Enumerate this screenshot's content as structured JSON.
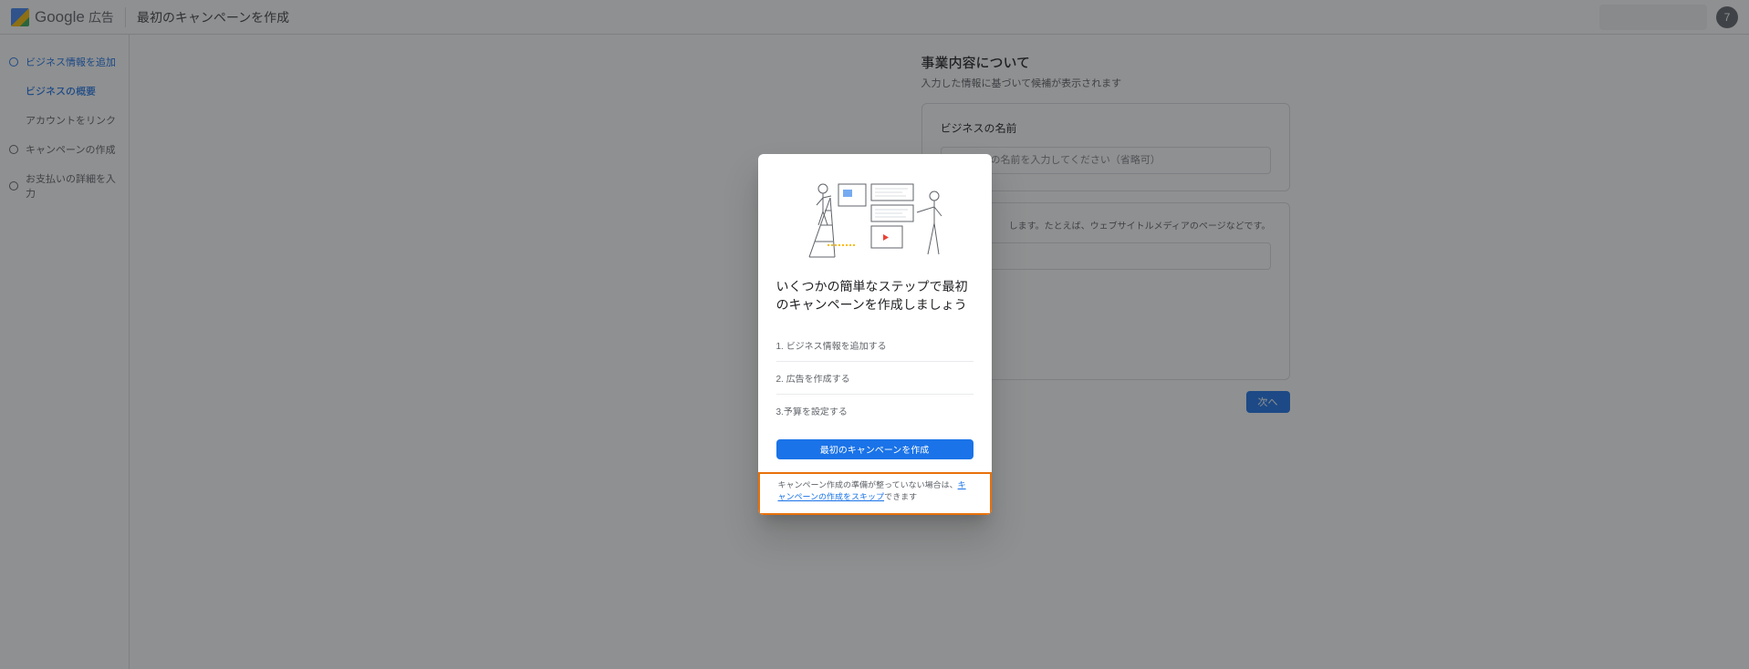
{
  "header": {
    "brand": "Google",
    "brand_suffix": "広告",
    "page_title": "最初のキャンペーンを作成",
    "avatar_initial": "7"
  },
  "sidebar": {
    "step1": "ビジネス情報を追加",
    "step1_sub1": "ビジネスの概要",
    "step1_sub2": "アカウントをリンク",
    "step2": "キャンペーンの作成",
    "step3": "お支払いの詳細を入力"
  },
  "main": {
    "heading": "事業内容について",
    "subtitle": "入力した情報に基づいて候補が表示されます",
    "card1_label": "ビジネスの名前",
    "card1_placeholder": "ビジネスの名前を入力してください（省略可）",
    "card2_text": "します。たとえば、ウェブサイトルメディアのページなどです。",
    "next_btn": "次へ"
  },
  "dialog": {
    "title": "いくつかの簡単なステップで最初のキャンペーンを作成しましょう",
    "step1": "1. ビジネス情報を追加する",
    "step2": "2. 広告を作成する",
    "step3": "3.予算を設定する",
    "primary_btn": "最初のキャンペーンを作成",
    "footer_pre": "キャンペーン作成の準備が整っていない場合は、",
    "footer_link": "キャンペーンの作成をスキップ",
    "footer_post": "できます"
  }
}
